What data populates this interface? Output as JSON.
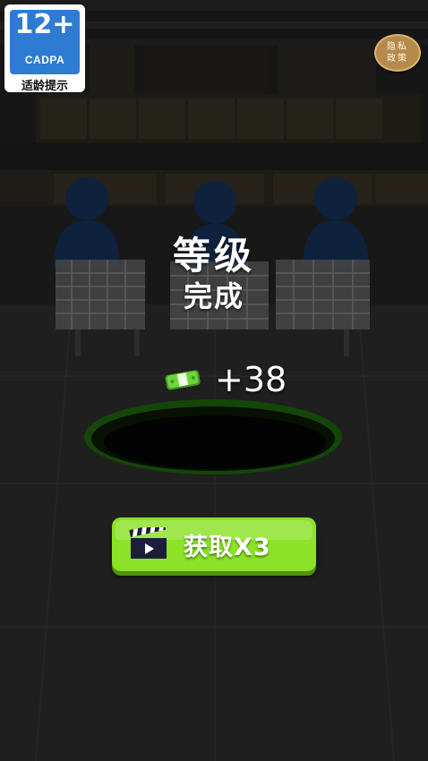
{
  "age_badge": {
    "rating": "12+",
    "org": "CADPA",
    "hint": "适龄提示"
  },
  "privacy_button": {
    "label": "隐私政策"
  },
  "result": {
    "title_line1": "等级",
    "title_line2": "完成"
  },
  "reward": {
    "amount": "+38",
    "icon": "cash-icon"
  },
  "claim_button": {
    "label": "获取X3",
    "icon": "clapperboard-icon",
    "color": "#8be226"
  },
  "colors": {
    "button_green": "#8be226",
    "hole_rim": "#1f6a0f",
    "figure_blue": "#16345e"
  }
}
